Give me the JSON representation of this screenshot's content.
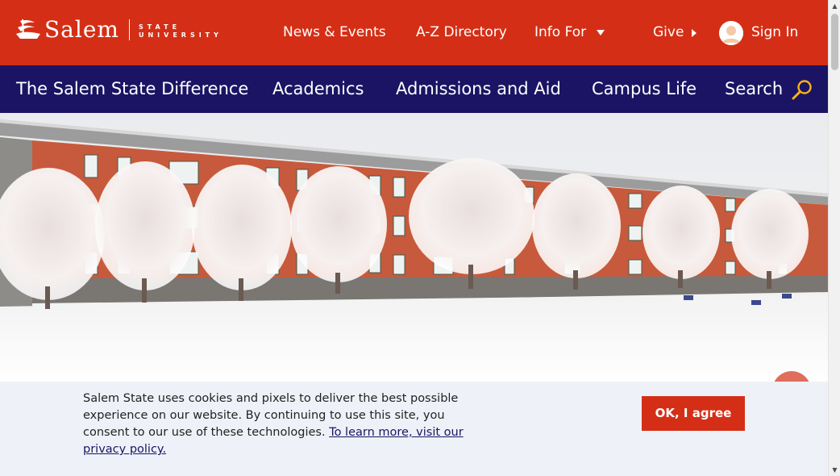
{
  "header": {
    "logo_word": "Salem",
    "logo_sub_line1": "STATE",
    "logo_sub_line2": "UNIVERSITY",
    "links": {
      "news": "News & Events",
      "directory": "A-Z Directory",
      "info_for": "Info For",
      "give": "Give",
      "sign_in": "Sign In"
    },
    "brand_color": "#d42f16"
  },
  "nav": {
    "items": [
      "The Salem State Difference",
      "Academics",
      "Admissions and Aid",
      "Campus Life"
    ],
    "search_label": "Search",
    "nav_color": "#1b1464"
  },
  "hero": {
    "icon": "campus-winter-photo"
  },
  "cookie": {
    "text": "Salem State uses cookies and pixels to deliver the best possible experience on our website. By continuing to use this site, you consent to our use of these technologies.",
    "link_text": "To learn more, visit our privacy policy.",
    "button_label": "OK, I agree"
  }
}
